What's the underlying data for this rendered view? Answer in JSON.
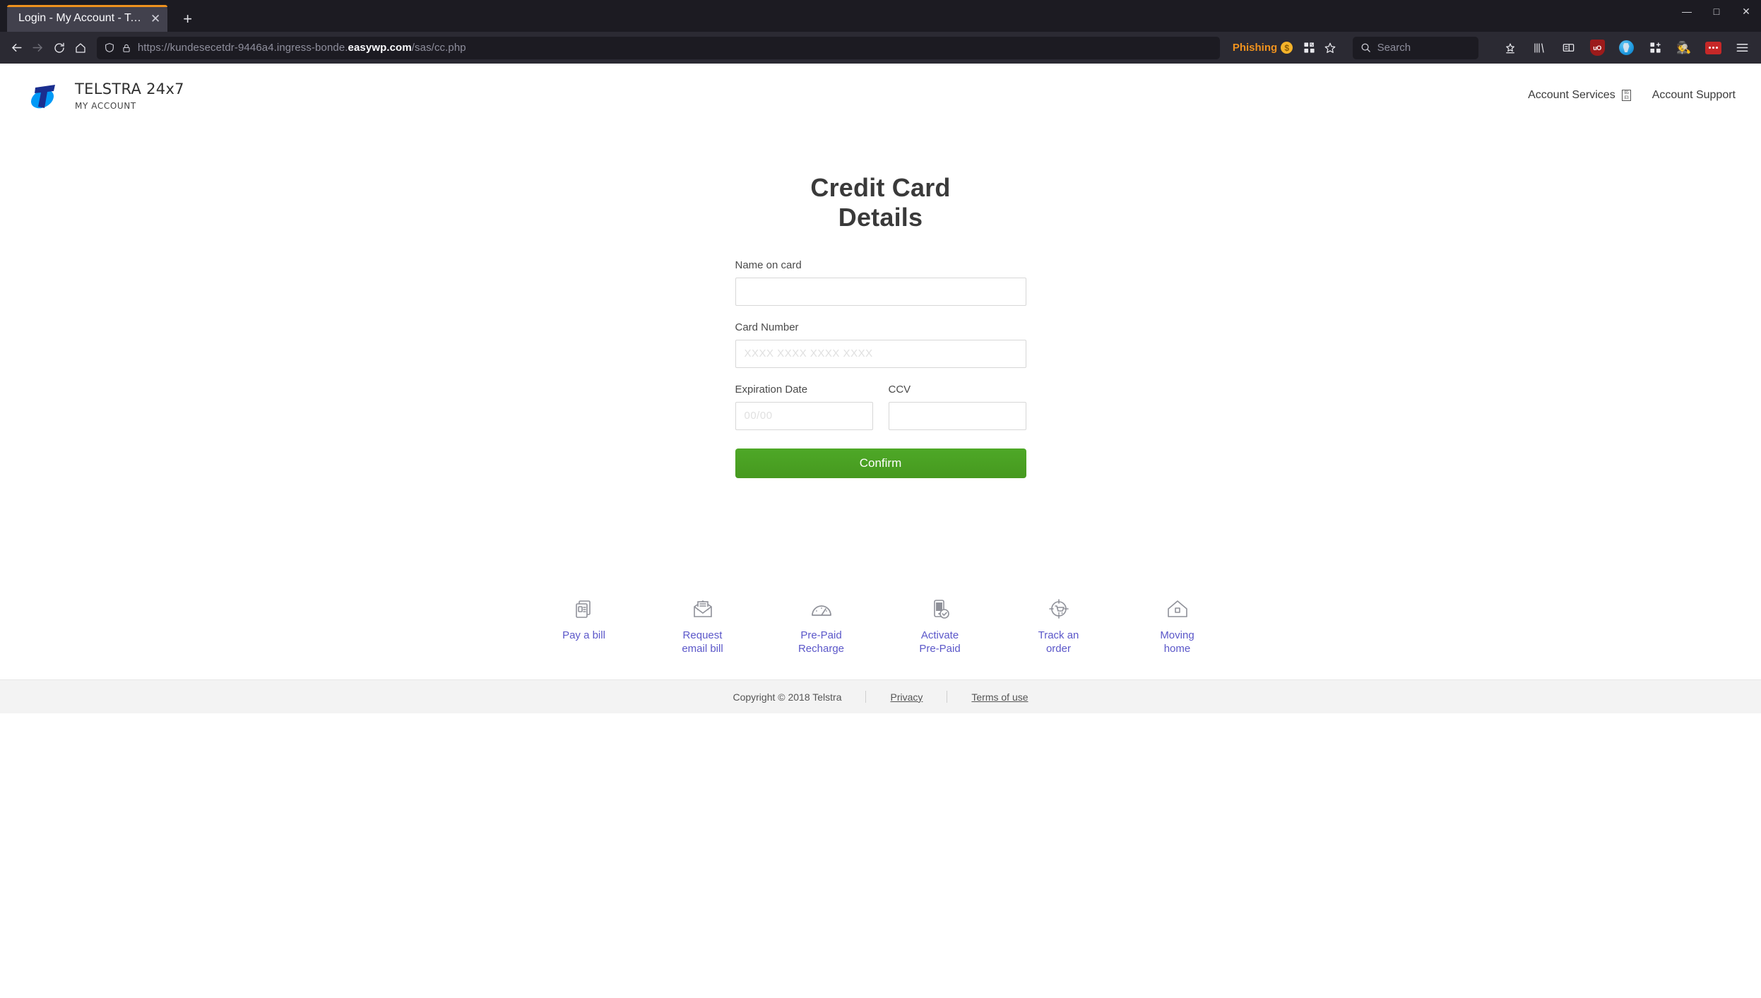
{
  "browser": {
    "tab": {
      "title": "Login - My Account - Telstra",
      "close_label": "✕"
    },
    "new_tab_label": "+",
    "window_controls": {
      "minimize": "—",
      "maximize": "□",
      "close": "✕"
    },
    "nav": {
      "back": "back-arrow",
      "forward": "forward-arrow",
      "reload": "reload",
      "home": "home"
    },
    "url": {
      "prefix": "https://kundesecetdr-9446a4.ingress-bonde.",
      "domain": "easywp.com",
      "path": "/sas/cc.php",
      "full": "https://kundesecetdr-9446a4.ingress-bonde.easywp.com/sas/cc.php"
    },
    "phishing": {
      "label": "Phishing",
      "badge": "$",
      "accent": "#f0921e"
    },
    "search": {
      "placeholder": "Search"
    },
    "extensions": [
      "pocket-save-icon",
      "library-icon",
      "reader-sidebar-icon",
      "ublock-origin-icon",
      "globe-extension-icon",
      "add-extension-icon",
      "agent-person-icon",
      "red-dots-extension-icon",
      "hamburger-menu-icon"
    ],
    "ublock_label": "uO"
  },
  "header": {
    "brand_title": "TELSTRA 24x7",
    "brand_sub": "MY ACCOUNT",
    "logo_colors": {
      "swoosh": "#0099f7",
      "t": "#1a2e8f"
    },
    "links": [
      {
        "label": "Account Services",
        "has_glyph_box": true,
        "glyph": "EG\nE3"
      },
      {
        "label": "Account Support",
        "has_glyph_box": false
      }
    ]
  },
  "form": {
    "title_line1": "Credit Card",
    "title_line2": "Details",
    "fields": [
      {
        "label": "Name on card",
        "value": "",
        "placeholder": ""
      },
      {
        "label": "Card Number",
        "value": "",
        "placeholder": "XXXX XXXX XXXX XXXX"
      },
      {
        "label": "Expiration Date",
        "value": "",
        "placeholder": "00/00"
      },
      {
        "label": "CCV",
        "value": "",
        "placeholder": ""
      }
    ],
    "submit_label": "Confirm",
    "submit_color": "#4ea827"
  },
  "quicklinks": [
    {
      "icon": "pay-a-bill-icon",
      "line1": "Pay a bill",
      "line2": ""
    },
    {
      "icon": "request-email-bill-icon",
      "line1": "Request",
      "line2": "email bill"
    },
    {
      "icon": "prepaid-recharge-icon",
      "line1": "Pre-Paid",
      "line2": "Recharge"
    },
    {
      "icon": "activate-prepaid-icon",
      "line1": "Activate",
      "line2": "Pre-Paid"
    },
    {
      "icon": "track-an-order-icon",
      "line1": "Track an",
      "line2": "order"
    },
    {
      "icon": "moving-home-icon",
      "line1": "Moving",
      "line2": "home"
    }
  ],
  "footer": {
    "copyright": "Copyright © 2018 Telstra",
    "privacy": "Privacy",
    "terms": "Terms of use"
  }
}
